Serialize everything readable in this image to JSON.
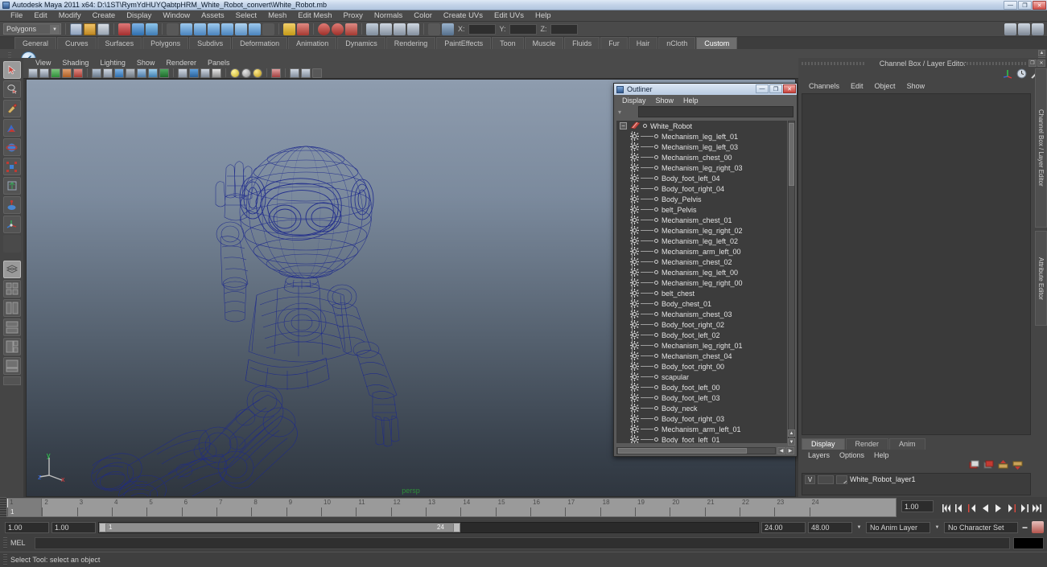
{
  "window": {
    "title": "Autodesk Maya 2011 x64: D:\\1ST\\RymYdHUYQabtpHRM_White_Robot_convert\\White_Robot.mb",
    "minimize": "—",
    "maximize": "❐",
    "close": "✕"
  },
  "menubar": {
    "items": [
      "File",
      "Edit",
      "Modify",
      "Create",
      "Display",
      "Window",
      "Assets",
      "Select",
      "Mesh",
      "Edit Mesh",
      "Proxy",
      "Normals",
      "Color",
      "Create UVs",
      "Edit UVs",
      "Help"
    ]
  },
  "statusbar": {
    "menu_set": "Polygons",
    "x_label": "X:",
    "y_label": "Y:",
    "z_label": "Z:",
    "x_value": "",
    "y_value": "",
    "z_value": ""
  },
  "shelf": {
    "tabs": [
      "General",
      "Curves",
      "Surfaces",
      "Polygons",
      "Subdivs",
      "Deformation",
      "Animation",
      "Dynamics",
      "Rendering",
      "PaintEffects",
      "Toon",
      "Muscle",
      "Fluids",
      "Fur",
      "Hair",
      "nCloth",
      "Custom"
    ],
    "active_tab": "Custom"
  },
  "viewport": {
    "menus": [
      "View",
      "Shading",
      "Lighting",
      "Show",
      "Renderer",
      "Panels"
    ],
    "camera_label": "persp",
    "axis": {
      "x": "x",
      "y": "y",
      "z": "z"
    }
  },
  "outliner": {
    "title": "Outliner",
    "menus": [
      "Display",
      "Show",
      "Help"
    ],
    "search_value": "",
    "root": "White_Robot",
    "items": [
      "Mechanism_leg_left_01",
      "Mechanism_leg_left_03",
      "Mechanism_chest_00",
      "Mechanism_leg_right_03",
      "Body_foot_left_04",
      "Body_foot_right_04",
      "Body_Pelvis",
      "belt_Pelvis",
      "Mechanism_chest_01",
      "Mechanism_leg_right_02",
      "Mechanism_leg_left_02",
      "Mechanism_arm_left_00",
      "Mechanism_chest_02",
      "Mechanism_leg_left_00",
      "Mechanism_leg_right_00",
      "belt_chest",
      "Body_chest_01",
      "Mechanism_chest_03",
      "Body_foot_right_02",
      "Body_foot_left_02",
      "Mechanism_leg_right_01",
      "Mechanism_chest_04",
      "Body_foot_right_00",
      "scapular",
      "Body_foot_left_00",
      "Body_foot_left_03",
      "Body_neck",
      "Body_foot_right_03",
      "Mechanism_arm_left_01",
      "Body_foot_left_01"
    ],
    "minimize": "—",
    "maximize": "❐",
    "close": "✕"
  },
  "right_dock": {
    "title": "Channel Box / Layer Editor",
    "menus": [
      "Channels",
      "Edit",
      "Object",
      "Show"
    ],
    "side_tabs": [
      "Channel Box / Layer Editor",
      "Attribute Editor"
    ],
    "layer_editor": {
      "tabs": [
        "Display",
        "Render",
        "Anim"
      ],
      "active_tab": "Display",
      "menus": [
        "Layers",
        "Options",
        "Help"
      ],
      "layers": [
        {
          "visibility": "V",
          "type": "",
          "name": "White_Robot_layer1"
        }
      ]
    }
  },
  "timeline": {
    "ticks": [
      "1",
      "2",
      "3",
      "4",
      "5",
      "6",
      "7",
      "8",
      "9",
      "10",
      "11",
      "12",
      "13",
      "14",
      "15",
      "16",
      "17",
      "18",
      "19",
      "20",
      "21",
      "22",
      "23",
      "24"
    ],
    "current_frame_marker": "1",
    "current_frame_field": "1.00",
    "playback_buttons": [
      "|◀◀",
      "|◀",
      "|◀",
      "◀",
      "▶",
      "▶|",
      "▶|",
      "▶▶|"
    ]
  },
  "range_slider": {
    "start": "1.00",
    "range_start": "1.00",
    "bar_start_label": "1",
    "bar_end_label": "24",
    "range_end": "24.00",
    "end": "48.00",
    "anim_layer": "No Anim Layer",
    "character_set": "No Character Set"
  },
  "command_line": {
    "label": "MEL",
    "value": ""
  },
  "help_line": {
    "text": "Select Tool: select an object"
  },
  "colors": {
    "wireframe": "#1e2a8c",
    "accent_green": "#2f8f3a",
    "accent_red": "#d2524b"
  }
}
